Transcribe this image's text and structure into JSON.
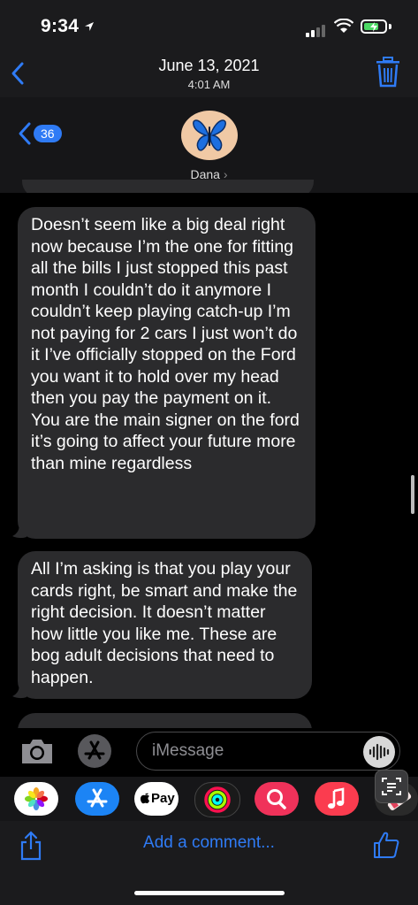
{
  "status_bar": {
    "time": "9:34"
  },
  "header": {
    "date": "June 13, 2021",
    "time": "4:01 AM"
  },
  "conversation": {
    "unread_count": "36",
    "contact_name": "Dana",
    "contact_chevron": "›"
  },
  "messages": [
    {
      "text": "Doesn’t seem like a big deal right now because I’m the one for fitting all the bills I just stopped this past month I couldn’t do it anymore I couldn’t keep playing catch-up I’m not paying for 2 cars I just won’t do it I’ve officially stopped on the Ford you want it to hold over my head then you pay the payment on it. You are the main signer on the ford it’s going to affect your future more than mine regardless"
    },
    {
      "text": "All I’m asking is that you play your cards right, be smart and make the right decision. It doesn’t matter how little you like me. These are bog adult decisions that need to happen."
    }
  ],
  "input": {
    "placeholder": "iMessage"
  },
  "apps": {
    "pay_label": "Pay"
  },
  "footer": {
    "comment_label": "Add a comment..."
  },
  "colors": {
    "accent": "#2f7bf5",
    "bubble": "#2b2b2d",
    "background": "#000000"
  },
  "icons": [
    "location-arrow-icon",
    "cellular-icon",
    "wifi-icon",
    "battery-icon",
    "back-chevron-icon",
    "trash-icon",
    "butterfly-icon",
    "camera-icon",
    "app-store-icon",
    "audio-icon",
    "photos-icon",
    "apple-pay-icon",
    "activity-icon",
    "search-images-icon",
    "music-icon",
    "live-text-icon",
    "share-icon",
    "thumbs-up-icon"
  ]
}
